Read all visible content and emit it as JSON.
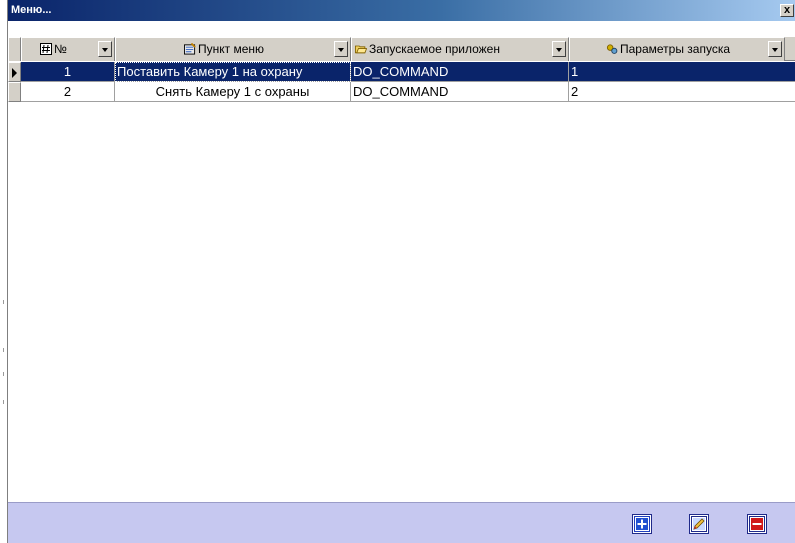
{
  "window": {
    "title": "Меню...",
    "close_symbol": "x"
  },
  "grid": {
    "columns": [
      {
        "label": "№",
        "icon": "number-field-icon"
      },
      {
        "label": "Пункт меню",
        "icon": "menu-item-icon"
      },
      {
        "label": "Запускаемое приложен",
        "icon": "folder-open-icon"
      },
      {
        "label": "Параметры запуска",
        "icon": "parameters-icon"
      }
    ],
    "rows": [
      {
        "num": "1",
        "item": "Поставить Камеру 1 на охрану",
        "app": "DO_COMMAND",
        "params": "1",
        "selected": true
      },
      {
        "num": "2",
        "item": "Снять Камеру 1 с охраны",
        "app": "DO_COMMAND",
        "params": "2",
        "selected": false
      }
    ]
  },
  "toolbar": {
    "buttons": [
      "add-icon",
      "edit-icon",
      "delete-icon"
    ]
  },
  "colors": {
    "selection": "#0a246a",
    "bottom_bar": "#c6c8f0",
    "add_blue": "#1f3fbf",
    "delete_red": "#d01818"
  }
}
